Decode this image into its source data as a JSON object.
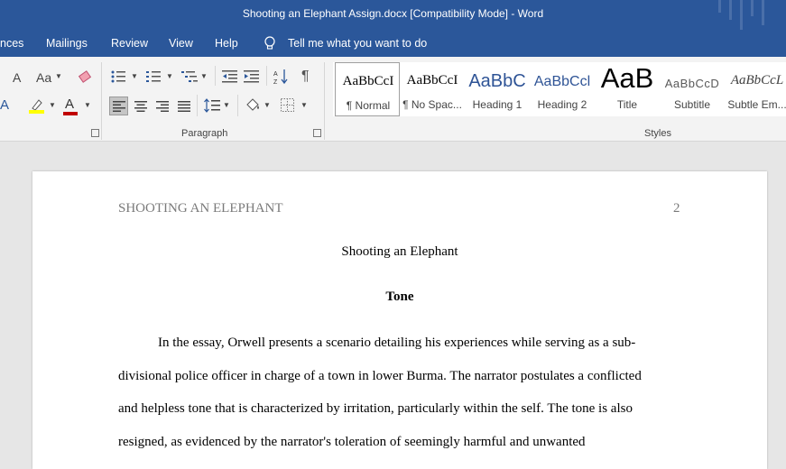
{
  "window": {
    "title": "Shooting an Elephant Assign.docx [Compatibility Mode]  -  Word"
  },
  "tabs": {
    "references_partial": "nces",
    "mailings": "Mailings",
    "review": "Review",
    "view": "View",
    "help": "Help",
    "tell_me": "Tell me what you want to do"
  },
  "ribbon": {
    "font_size_partial": "A",
    "change_case": "Aa",
    "paragraph_label": "Paragraph",
    "styles_label": "Styles",
    "pilcrow": "¶",
    "styles": [
      {
        "preview": "AaBbCcI",
        "name": "¶ Normal"
      },
      {
        "preview": "AaBbCcI",
        "name": "¶ No Spac..."
      },
      {
        "preview": "AaBbC",
        "name": "Heading 1"
      },
      {
        "preview": "AaBbCcl",
        "name": "Heading 2"
      },
      {
        "preview": "AaB",
        "name": "Title"
      },
      {
        "preview": "AaBbCcD",
        "name": "Subtitle"
      },
      {
        "preview": "AaBbCcL",
        "name": "Subtle Em..."
      }
    ],
    "colors": {
      "highlight": "#ffff00",
      "font_color": "#c00000",
      "accent": "#2b579a"
    }
  },
  "document": {
    "header_title": "SHOOTING AN ELEPHANT",
    "page_number": "2",
    "title": "Shooting an Elephant",
    "heading": "Tone",
    "paragraph_lines": [
      "In the essay, Orwell presents a scenario detailing his experiences while serving as a sub-",
      "divisional police officer in charge of a town in lower Burma. The narrator postulates a conflicted",
      "and helpless tone that is characterized by irritation, particularly within the self. The tone is also",
      "resigned, as evidenced by the narrator's toleration of seemingly harmful and unwanted"
    ]
  }
}
